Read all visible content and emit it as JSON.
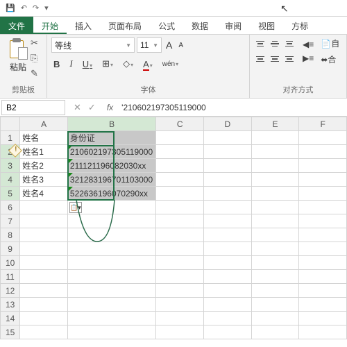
{
  "qat": {
    "save": "💾",
    "undo": "↶",
    "redo": "↷",
    "more": "▾"
  },
  "tabs": {
    "file": "文件",
    "home": "开始",
    "insert": "插入",
    "layout": "页面布局",
    "formula": "公式",
    "data": "数据",
    "review": "审阅",
    "view": "视图",
    "dev": "方标"
  },
  "ribbon": {
    "clipboard": {
      "label": "剪贴板",
      "paste": "粘贴",
      "cut": "✂",
      "copy": "⎘",
      "brush": "✎"
    },
    "font": {
      "label": "字体",
      "name": "等线",
      "size": "11",
      "growA": "A",
      "shrinkA": "A",
      "b": "B",
      "i": "I",
      "u": "U",
      "border": "⊞",
      "fill": "◇",
      "color": "A",
      "wen": "wén"
    },
    "align": {
      "label": "对齐方式",
      "wrap": "自",
      "merge": "合"
    }
  },
  "namebox": {
    "ref": "B2",
    "x": "✕",
    "check": "✓"
  },
  "formula": "'210602197305119000",
  "cols": [
    "A",
    "B",
    "C",
    "D",
    "E",
    "F"
  ],
  "rows": [
    "1",
    "2",
    "3",
    "4",
    "5",
    "6",
    "7",
    "8",
    "9",
    "10",
    "11",
    "12",
    "13",
    "14",
    "15"
  ],
  "cells": {
    "A1": "姓名",
    "B1": "身份证",
    "A2": "姓名1",
    "B2": "210602197305119000",
    "A3": "姓名2",
    "B3": "211121196082030xx",
    "A4": "姓名3",
    "B4": "321283196701103000",
    "A5": "姓名4",
    "B5": "522636196070290xx"
  },
  "chart_data": {
    "type": "table",
    "columns": [
      "姓名",
      "身份证"
    ],
    "rows": [
      [
        "姓名1",
        "210602197305119000"
      ],
      [
        "姓名2",
        "211121196082030xx"
      ],
      [
        "姓名3",
        "321283196701103000"
      ],
      [
        "姓名4",
        "522636196070290xx"
      ]
    ]
  }
}
